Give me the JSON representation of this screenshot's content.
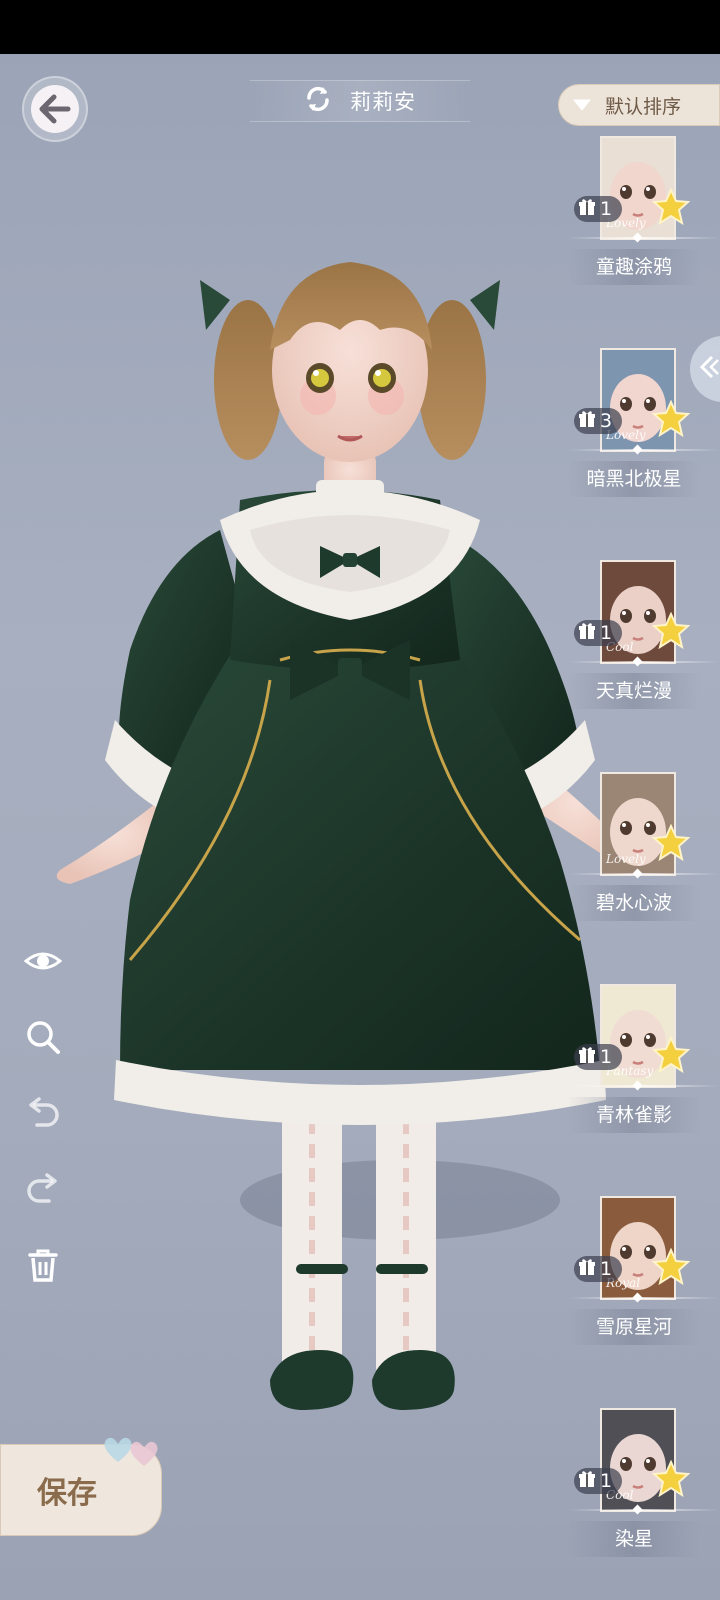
{
  "header": {
    "character_name": "莉莉安",
    "sort_label": "默认排序"
  },
  "sidebar_tools": [
    "eye-icon",
    "zoom-icon",
    "undo-icon",
    "redo-icon",
    "trash-icon"
  ],
  "save_label": "保存",
  "looks": [
    {
      "style": "Lovely",
      "count": "1",
      "name": "童趣涂鸦",
      "skin": "#f0d6cc",
      "hair": "#e9dfd5"
    },
    {
      "style": "Lovely",
      "count": "3",
      "name": "暗黑北极星",
      "skin": "#f1d5cf",
      "hair": "#7e95b0"
    },
    {
      "style": "Cool",
      "count": "1",
      "name": "天真烂漫",
      "skin": "#ead0c6",
      "hair": "#6e4a3c"
    },
    {
      "style": "Lovely",
      "count": "",
      "name": "碧水心波",
      "skin": "#eed7cc",
      "hair": "#9b8574"
    },
    {
      "style": "Fantasy",
      "count": "1",
      "name": "青林雀影",
      "skin": "#f0dcd2",
      "hair": "#efe8d2"
    },
    {
      "style": "Royal",
      "count": "1",
      "name": "雪原星河",
      "skin": "#eed5c8",
      "hair": "#8a5b3c"
    },
    {
      "style": "Cool",
      "count": "1",
      "name": "染星",
      "skin": "#ead7d3",
      "hair": "#4f4f55"
    }
  ],
  "colors": {
    "dress": "#1e3a2c",
    "lace": "#f1ede8",
    "hair": "#a9814f",
    "star": "#f4cf3e"
  }
}
